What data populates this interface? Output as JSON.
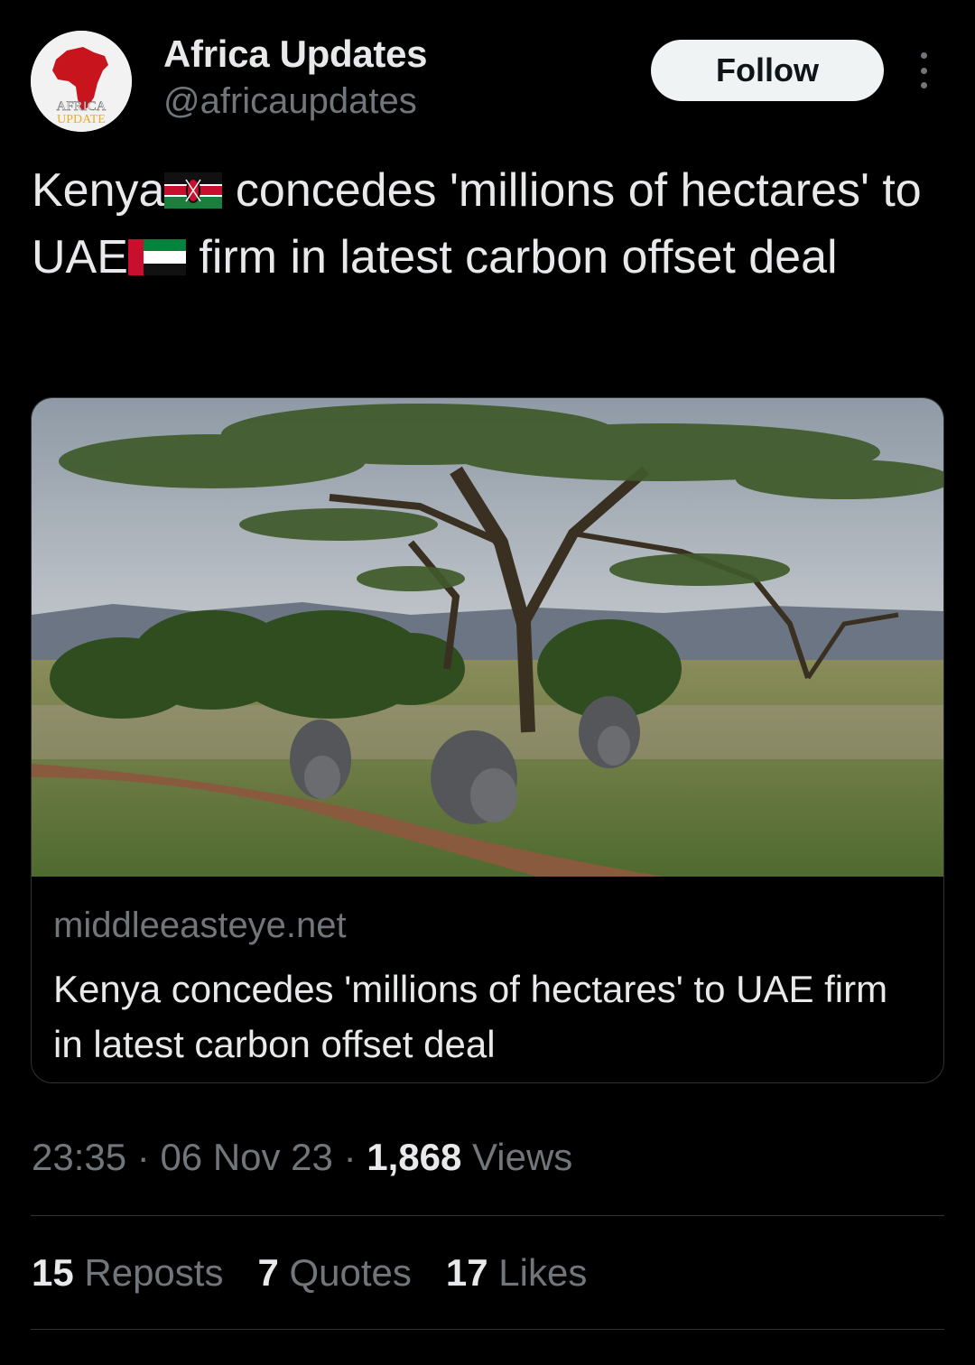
{
  "author": {
    "name": "Africa Updates",
    "handle": "@africaupdates",
    "avatar_text_top": "AFRICA",
    "avatar_text_bottom": "UPDATE"
  },
  "follow_label": "Follow",
  "tweet": {
    "text_part1": "Kenya",
    "text_part2": " concedes 'millions of hectares' to UAE",
    "text_part3": " firm in latest carbon offset deal",
    "flags": [
      "kenya-flag",
      "uae-flag"
    ]
  },
  "card": {
    "domain": "middleeasteye.net",
    "title": "Kenya concedes 'millions of hectares' to UAE firm in latest carbon offset deal"
  },
  "meta": {
    "time": "23:35",
    "sep1": " · ",
    "date": "06 Nov 23",
    "sep2": " · ",
    "views_count": "1,868",
    "views_label": " Views"
  },
  "stats": {
    "reposts_count": "15",
    "reposts_label": " Reposts",
    "quotes_count": "7",
    "quotes_label": " Quotes",
    "likes_count": "17",
    "likes_label": " Likes"
  },
  "colors": {
    "background": "#000000",
    "text_primary": "#e7e9ea",
    "text_secondary": "#71767b",
    "border": "#2f3336",
    "follow_bg": "#eff3f4"
  }
}
